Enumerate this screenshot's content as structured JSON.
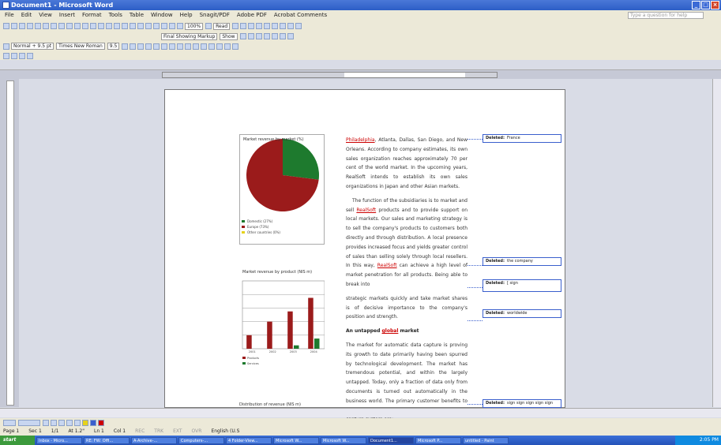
{
  "title": "Document1 - Microsoft Word",
  "menu": [
    "File",
    "Edit",
    "View",
    "Insert",
    "Format",
    "Tools",
    "Table",
    "Window",
    "Help",
    "Snagit/PDF",
    "Adobe PDF",
    "Acrobat Comments"
  ],
  "ask_placeholder": "Type a question for help",
  "toolbar": {
    "zoom": "100%",
    "read_button": "Read",
    "markup_view": "Final Showing Markup",
    "show_button": "Show",
    "style": "Normal + 9.5 pt",
    "font": "Times New Roman",
    "size": "9.5"
  },
  "charts": [
    {
      "title": "Market revenue by market (%)",
      "legend": [
        "Domestic (27%)",
        "Europe (73%)",
        "Other countries (0%)"
      ],
      "colors": [
        "#1e7a2e",
        "#9b1b1b",
        "#e6d21a"
      ]
    },
    {
      "title": "Market revenue by product (NIS m)",
      "categories": [
        "2001",
        "2002",
        "2003",
        "2004"
      ],
      "colors": [
        "#9b1b1b",
        "#1e7a2e"
      ],
      "legend": [
        "Products",
        "Services"
      ]
    },
    {
      "title": "Distribution of revenue (NIS m)"
    }
  ],
  "chart_data": {
    "type": "bar",
    "title": "Market revenue by product (NIS m)",
    "categories": [
      "2001",
      "2002",
      "2003",
      "2004"
    ],
    "series": [
      {
        "name": "Products",
        "values": [
          2,
          4,
          5.5,
          7.5
        ]
      },
      {
        "name": "Services",
        "values": [
          0,
          0,
          0.5,
          1.5
        ]
      }
    ],
    "ylim": [
      0,
      10
    ]
  },
  "pie_data": {
    "type": "pie",
    "title": "Market revenue by market (%)",
    "values": [
      27,
      73,
      0
    ],
    "labels": [
      "Domestic (27%)",
      "Europe (73%)",
      "Other countries (0%)"
    ]
  },
  "doc": {
    "p1_start": "Philadelphia",
    "p1": ", Atlanta, Dallas, San Diego, and New Orleans. According to company estimates, its own sales organization reaches approximately 70 per cent of the world market. In the upcoming years, RealSoft intends to establish its own sales organizations in Japan and other Asian markets.",
    "p2_a": "The function of the subsidiaries is to market and sell ",
    "p2_b": "RealSoft",
    "p2_c": " products and to provide support on local markets. Our sales and marketing strategy is to sell the company's products to customers both directly and through distribution. A local presence provides increased focus and yields greater control of sales than selling solely through local resellers. In this way, ",
    "p2_d": "RealSoft",
    "p2_e": " can achieve a high level of market penetration for all products. Being able to break into",
    "p3": "strategic markets quickly and take market shares is of decisive importance to the company's position and strength.",
    "h1_a": "An untapped ",
    "h1_b": "global",
    "h1_c": " market",
    "p4": "The market for automatic data capture is proving its growth to date primarily having been spurred by technological development. The market has tremendous potential, and within the largely untapped. Today, only a fraction of data only from documents is turned out automatically in the business world. The primary customer benefits to be derived from investing in an automatic data capture system are:"
  },
  "balloons": [
    {
      "label": "Deleted:",
      "text": "France"
    },
    {
      "label": "Deleted:",
      "text": "the company"
    },
    {
      "label": "Deleted:",
      "text": "[ sign"
    },
    {
      "label": "Deleted:",
      "text": "worldwide"
    },
    {
      "label": "Deleted:",
      "text": "sign sign sign sign sign"
    }
  ],
  "status": [
    "Page 1",
    "Sec 1",
    "1/1",
    "At 1.2\"",
    "Ln 1",
    "Col 1",
    "REC",
    "TRK",
    "EXT",
    "OVR",
    "English (U.S"
  ],
  "taskbar": {
    "start": "start",
    "items": [
      "Inbox - Micro...",
      "RE: FW: Offi...",
      "A-Archive-...",
      "Computers-...",
      "4 Folder-View...",
      "Microsoft W...",
      "Microsoft W...",
      "Document1...",
      "Microsoft P...",
      "untitled - Paint"
    ],
    "clock": "2:05 PM"
  }
}
